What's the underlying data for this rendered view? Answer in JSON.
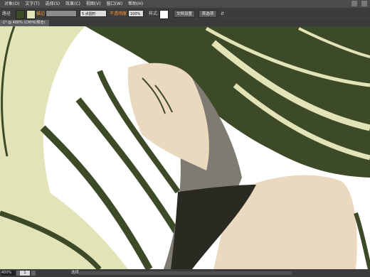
{
  "menu": {
    "items": [
      "对象(O)",
      "文字(T)",
      "选择(S)",
      "效果(C)",
      "视图(V)",
      "窗口(W)",
      "帮助(H)"
    ]
  },
  "control_bar": {
    "path_label": "路径",
    "stroke_label": "描边",
    "brush_label": "5 点圆形",
    "opacity_label": "不透明度",
    "opacity_value": "100%",
    "style_label": "样式:",
    "doc_setup_button": "文档设置",
    "preferences_button": "首选项"
  },
  "doc_tab": {
    "label": "-1* @ 400% (CMYK/预览)"
  },
  "status": {
    "zoom": "400%",
    "page": "1",
    "mode": "选择"
  },
  "colors": {
    "hair_dark": "#3d4a27",
    "hair_light": "#e3e3b8",
    "skin": "#ead8bf",
    "shadow_grey": "#7d7b72",
    "ui_dark": "#3c3c3c"
  }
}
